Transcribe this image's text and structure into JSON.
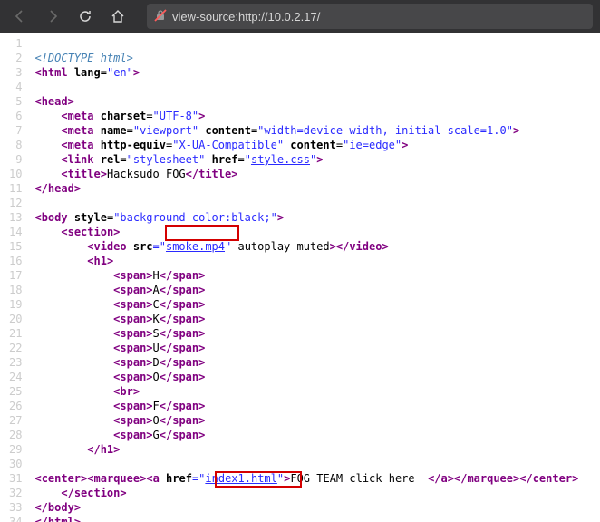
{
  "toolbar": {
    "url": "view-source:http://10.0.2.17/"
  },
  "lines": {
    "l1": {
      "doctype": "<!DOCTYPE html>"
    },
    "l2": {
      "open": "html",
      "a1n": "lang",
      "a1v": "\"en\""
    },
    "l4": {
      "open": "head"
    },
    "l5": {
      "voidtag": "meta",
      "a1n": "charset",
      "a1v": "\"UTF-8\""
    },
    "l6": {
      "voidtag": "meta",
      "a1n": "name",
      "a1v": "\"viewport\"",
      "a2n": "content",
      "a2v": "\"width=device-width, initial-scale=1.0\""
    },
    "l7": {
      "voidtag": "meta",
      "a1n": "http-equiv",
      "a1v": "\"X-UA-Compatible\"",
      "a2n": "content",
      "a2v": "\"ie=edge\""
    },
    "l8": {
      "voidtag": "link",
      "a1n": "rel",
      "a1v": "\"stylesheet\"",
      "a2n": "href",
      "a2vq1": "\"",
      "a2vlink": "style.css",
      "a2vq2": "\""
    },
    "l9": {
      "open": "title",
      "text": "Hacksudo FOG",
      "close": "title"
    },
    "l10": {
      "close": "head"
    },
    "l12": {
      "open": "body",
      "a1n": "style",
      "a1v": "\"background-color:black;\""
    },
    "l13": {
      "open": "section"
    },
    "l14": {
      "open": "video",
      "a1n": "src",
      "a1vq1": "=\"",
      "a1vlink": "smoke.mp4",
      "a1vq2": "\"",
      "plain": " autoplay muted",
      "close": "video"
    },
    "l15": {
      "open": "h1"
    },
    "l16": {
      "open": "span",
      "text": "H",
      "close": "span"
    },
    "l17": {
      "open": "span",
      "text": "A",
      "close": "span"
    },
    "l18": {
      "open": "span",
      "text": "C",
      "close": "span"
    },
    "l19": {
      "open": "span",
      "text": "K",
      "close": "span"
    },
    "l20": {
      "open": "span",
      "text": "S",
      "close": "span"
    },
    "l21": {
      "open": "span",
      "text": "U",
      "close": "span"
    },
    "l22": {
      "open": "span",
      "text": "D",
      "close": "span"
    },
    "l23": {
      "open": "span",
      "text": "O",
      "close": "span"
    },
    "l24": {
      "voidtag": "br"
    },
    "l25": {
      "open": "span",
      "text": "F",
      "close": "span"
    },
    "l26": {
      "open": "span",
      "text": "O",
      "close": "span"
    },
    "l27": {
      "open": "span",
      "text": "G",
      "close": "span"
    },
    "l28": {
      "close": "h1"
    },
    "l30": {
      "open1": "center",
      "open2": "marquee",
      "open3": "a",
      "a1n": "href",
      "a1vq1": "=\"",
      "a1vlink": "index1.html",
      "a1vq2": "\"",
      "text": "FOG TEAM click here  ",
      "close3": "a",
      "close2": "marquee",
      "close1": "center"
    },
    "l31": {
      "close": "section"
    },
    "l32": {
      "close": "body"
    },
    "l33": {
      "close": "html"
    }
  },
  "gutter": " 1\n 2\n 3\n 4\n 5\n 6\n 7\n 8\n 9\n10\n11\n12\n13\n14\n15\n16\n17\n18\n19\n20\n21\n22\n23\n24\n25\n26\n27\n28\n29\n30\n31\n32\n33\n34"
}
